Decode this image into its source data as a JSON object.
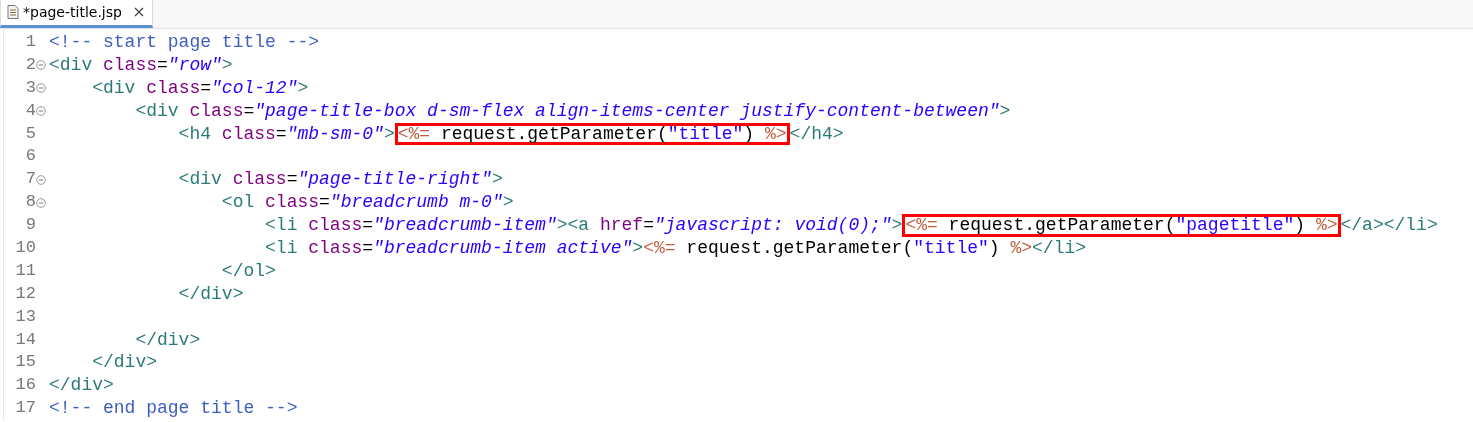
{
  "tabs": [
    {
      "label": "*page-title.jsp",
      "selected": true
    }
  ],
  "lines": [
    {
      "number": "1",
      "foldable": false,
      "tokens": [
        {
          "kind": "comment",
          "text": "<!-- start page title -->"
        }
      ]
    },
    {
      "number": "2",
      "foldable": true,
      "tokens": [
        {
          "kind": "tag",
          "text": "<div"
        },
        {
          "kind": "attr",
          "text": " class"
        },
        {
          "kind": "plain",
          "text": "="
        },
        {
          "kind": "value",
          "text": "\"row\""
        },
        {
          "kind": "tag",
          "text": ">"
        }
      ]
    },
    {
      "number": "3",
      "foldable": true,
      "tokens": [
        {
          "kind": "tag",
          "text": "    <div"
        },
        {
          "kind": "attr",
          "text": " class"
        },
        {
          "kind": "plain",
          "text": "="
        },
        {
          "kind": "value",
          "text": "\"col-12\""
        },
        {
          "kind": "tag",
          "text": ">"
        }
      ]
    },
    {
      "number": "4",
      "foldable": true,
      "tokens": [
        {
          "kind": "tag",
          "text": "        <div"
        },
        {
          "kind": "attr",
          "text": " class"
        },
        {
          "kind": "plain",
          "text": "="
        },
        {
          "kind": "value",
          "text": "\"page-title-box d-sm-flex align-items-center justify-content-between\""
        },
        {
          "kind": "tag",
          "text": ">"
        }
      ]
    },
    {
      "number": "5",
      "foldable": false,
      "tokens": [
        {
          "kind": "tag",
          "text": "            <h4"
        },
        {
          "kind": "attr",
          "text": " class"
        },
        {
          "kind": "plain",
          "text": "="
        },
        {
          "kind": "value",
          "text": "\"mb-sm-0\""
        },
        {
          "kind": "tag",
          "text": ">"
        }
      ],
      "boxed": [
        {
          "kind": "jsp",
          "text": "<%="
        },
        {
          "kind": "plain",
          "text": " request.getParameter("
        },
        {
          "kind": "string",
          "text": "\"title\""
        },
        {
          "kind": "plain",
          "text": ") "
        },
        {
          "kind": "jsp",
          "text": "%>"
        }
      ],
      "rest": [
        {
          "kind": "tag",
          "text": "</h4>"
        }
      ]
    },
    {
      "number": "6",
      "foldable": false
    },
    {
      "number": "7",
      "foldable": true,
      "tokens": [
        {
          "kind": "tag",
          "text": "            <div"
        },
        {
          "kind": "attr",
          "text": " class"
        },
        {
          "kind": "plain",
          "text": "="
        },
        {
          "kind": "value",
          "text": "\"page-title-right\""
        },
        {
          "kind": "tag",
          "text": ">"
        }
      ]
    },
    {
      "number": "8",
      "foldable": true,
      "tokens": [
        {
          "kind": "tag",
          "text": "                <ol"
        },
        {
          "kind": "attr",
          "text": " class"
        },
        {
          "kind": "plain",
          "text": "="
        },
        {
          "kind": "value",
          "text": "\"breadcrumb m-0\""
        },
        {
          "kind": "tag",
          "text": ">"
        }
      ]
    },
    {
      "number": "9",
      "foldable": false,
      "tokens": [
        {
          "kind": "tag",
          "text": "                    <li"
        },
        {
          "kind": "attr",
          "text": " class"
        },
        {
          "kind": "plain",
          "text": "="
        },
        {
          "kind": "value",
          "text": "\"breadcrumb-item\""
        },
        {
          "kind": "tag",
          "text": "><a"
        },
        {
          "kind": "attr",
          "text": " href"
        },
        {
          "kind": "plain",
          "text": "="
        },
        {
          "kind": "value",
          "text": "\"javascript: void(0);\""
        },
        {
          "kind": "tag",
          "text": ">"
        }
      ],
      "boxed": [
        {
          "kind": "jsp",
          "text": "<%="
        },
        {
          "kind": "plain",
          "text": " request.getParameter("
        },
        {
          "kind": "string",
          "text": "\"pagetitle\""
        },
        {
          "kind": "plain",
          "text": ") "
        },
        {
          "kind": "jsp",
          "text": "%>"
        }
      ],
      "rest": [
        {
          "kind": "tag",
          "text": "</a></li>"
        }
      ]
    },
    {
      "number": "10",
      "foldable": false,
      "tokens": [
        {
          "kind": "tag",
          "text": "                    <li"
        },
        {
          "kind": "attr",
          "text": " class"
        },
        {
          "kind": "plain",
          "text": "="
        },
        {
          "kind": "value",
          "text": "\"breadcrumb-item active\""
        },
        {
          "kind": "tag",
          "text": ">"
        },
        {
          "kind": "jsp",
          "text": "<%="
        },
        {
          "kind": "plain",
          "text": " request.getParameter("
        },
        {
          "kind": "string",
          "text": "\"title\""
        },
        {
          "kind": "plain",
          "text": ") "
        },
        {
          "kind": "jsp",
          "text": "%>"
        },
        {
          "kind": "tag",
          "text": "</li>"
        }
      ]
    },
    {
      "number": "11",
      "foldable": false,
      "tokens": [
        {
          "kind": "tag",
          "text": "                </ol>"
        }
      ]
    },
    {
      "number": "12",
      "foldable": false,
      "tokens": [
        {
          "kind": "tag",
          "text": "            </div>"
        }
      ]
    },
    {
      "number": "13",
      "foldable": false
    },
    {
      "number": "14",
      "foldable": false,
      "tokens": [
        {
          "kind": "tag",
          "text": "        </div>"
        }
      ]
    },
    {
      "number": "15",
      "foldable": false,
      "tokens": [
        {
          "kind": "tag",
          "text": "    </div>"
        }
      ]
    },
    {
      "number": "16",
      "foldable": false,
      "tokens": [
        {
          "kind": "tag",
          "text": "</div>"
        }
      ]
    },
    {
      "number": "17",
      "foldable": false,
      "tokens": [
        {
          "kind": "comment",
          "text": "<!-- end page title -->"
        }
      ]
    }
  ]
}
